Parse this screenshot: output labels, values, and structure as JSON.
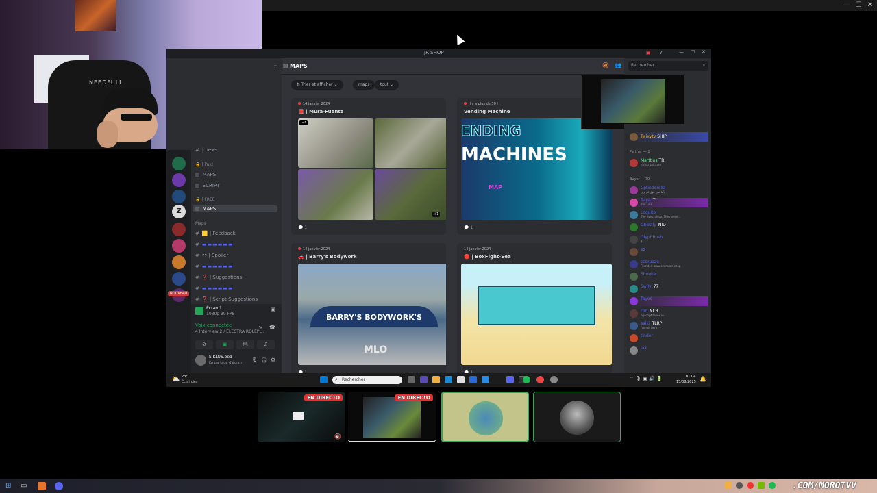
{
  "discord": {
    "window_title": "JR SHOP",
    "channels": [
      {
        "label": "| news",
        "kind": "text"
      },
      {
        "label": "| Paid",
        "kind": "category"
      },
      {
        "label": "MAPS",
        "kind": "forum"
      },
      {
        "label": "SCRIPT",
        "kind": "forum"
      },
      {
        "label": "| FREE",
        "kind": "category"
      },
      {
        "label": "MAPS",
        "kind": "forum-active"
      },
      {
        "label": "Maps",
        "kind": "category"
      },
      {
        "label": "| Feedback",
        "kind": "text"
      },
      {
        "label": "| Spoiler",
        "kind": "text"
      },
      {
        "label": "| Suggestions",
        "kind": "text"
      },
      {
        "label": "| Script-Suggestions",
        "kind": "text"
      }
    ],
    "nouveau_badge": "NOUVEAU",
    "voice": {
      "screen_label": "Écran 1",
      "screen_sub": "1080p 30 FPS",
      "connected": "Voix connectée",
      "channel": "4 Interview 2 / ELECTRA ROLEPL...",
      "user": "SIKLUS.eed",
      "user_status": "En partage d'écran"
    },
    "forum": {
      "name": "MAPS",
      "sort_label": "Trier et afficher",
      "tags": [
        "maps",
        "tout"
      ],
      "posts": [
        {
          "date": "14 janvier 2024",
          "title": "| Mura-Fuente",
          "count": "1",
          "badge": "GIF",
          "extra": "+1"
        },
        {
          "date": "Il y a plus de 30 j",
          "title": "Vending Machine",
          "count": "1",
          "banner_line1": "ENDING",
          "banner_line2": "MACHINES",
          "banner_tag": "MAP"
        },
        {
          "date": "14 janvier 2024",
          "title": "| Barry's Bodywork",
          "count": "1",
          "banner": "BARRY'S BODYWORK'S",
          "banner_sub": "MLO"
        },
        {
          "date": "14 janvier 2024",
          "title": "| BoxFight-Sea",
          "count": "1"
        }
      ]
    },
    "search_placeholder": "Rechercher",
    "members": {
      "partner_header": "Partner — 1",
      "buyer_header": "Buyer — 70",
      "top_member": "Twixytv",
      "top_member_tag": "SHIP",
      "partner": {
        "name": "Marttins",
        "tag": "TR",
        "status": "mt-scripts.com"
      },
      "buyers": [
        {
          "name": "Cptinderella",
          "tag": "",
          "status": "لأننا نحن فوق لم نريح"
        },
        {
          "name": "flaya",
          "tag": "TL",
          "status": "The Line"
        },
        {
          "name": "Loquito",
          "tag": "",
          "status": "The eyes, chico. They neve..."
        },
        {
          "name": "Ghostly",
          "tag": "NID",
          "status": ""
        },
        {
          "name": "GlyphRush",
          "tag": "",
          "status": "$"
        },
        {
          "name": "ez",
          "tag": "",
          "status": ""
        },
        {
          "name": "scorpaze",
          "tag": "",
          "status": "Founder: www.scorpaze.shop"
        },
        {
          "name": "Shoukei",
          "tag": "",
          "status": ""
        },
        {
          "name": "Swily",
          "tag": "77",
          "status": ""
        },
        {
          "name": "Tayoo",
          "tag": "",
          "status": ""
        },
        {
          "name": "rbn",
          "tag": "NCR",
          "status": "ngscript.tebex.io"
        },
        {
          "name": "saiki",
          "tag": "TLRP",
          "status": "I'm not here"
        },
        {
          "name": "tinder",
          "tag": "",
          "status": ""
        },
        {
          "name": "Jax",
          "tag": "",
          "status": ""
        }
      ]
    }
  },
  "inner_taskbar": {
    "weather_temp": "23°C",
    "weather_desc": "Éclaircies",
    "search": "Rechercher",
    "time": "01:04",
    "date": "15/08/2025"
  },
  "stream_tiles": [
    {
      "live": "EN DIRECTO"
    },
    {
      "live": "EN DIRECTO"
    },
    {
      "live": ""
    },
    {
      "live": ""
    }
  ],
  "webcam_brand": "NEEDFULL",
  "watermark": ".COM/MOROTVV",
  "colors": {
    "discord_bg": "#313338",
    "blurple": "#5865f2",
    "live_red": "#e03434",
    "tile_border": "#3ba55c"
  }
}
